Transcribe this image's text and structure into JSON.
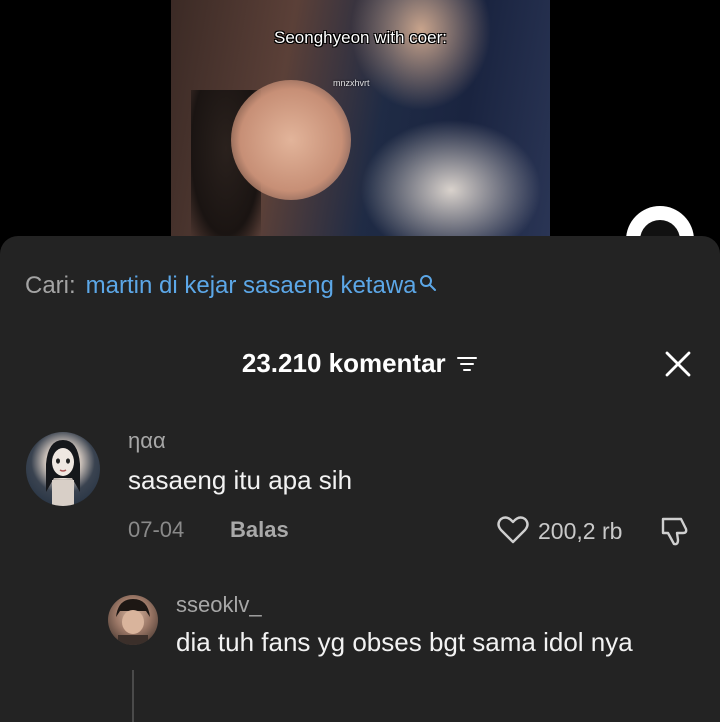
{
  "video": {
    "caption": "Seonghyeon with coer:",
    "watermark": "mnzxhvrt"
  },
  "search": {
    "prefix": "Cari:",
    "query": "martin di kejar sasaeng ketawa"
  },
  "comments_header": {
    "count_label": "23.210 komentar"
  },
  "comments": [
    {
      "username": "ηαα",
      "text": "sasaeng itu apa sih",
      "date": "07-04",
      "reply_label": "Balas",
      "likes": "200,2 rb"
    },
    {
      "username": "sseoklv_",
      "text": "dia tuh fans yg obses bgt sama idol nya"
    }
  ],
  "colors": {
    "sheet_bg": "#232323",
    "link_blue": "#5ca7e7",
    "muted_text": "#a7a7a7"
  }
}
